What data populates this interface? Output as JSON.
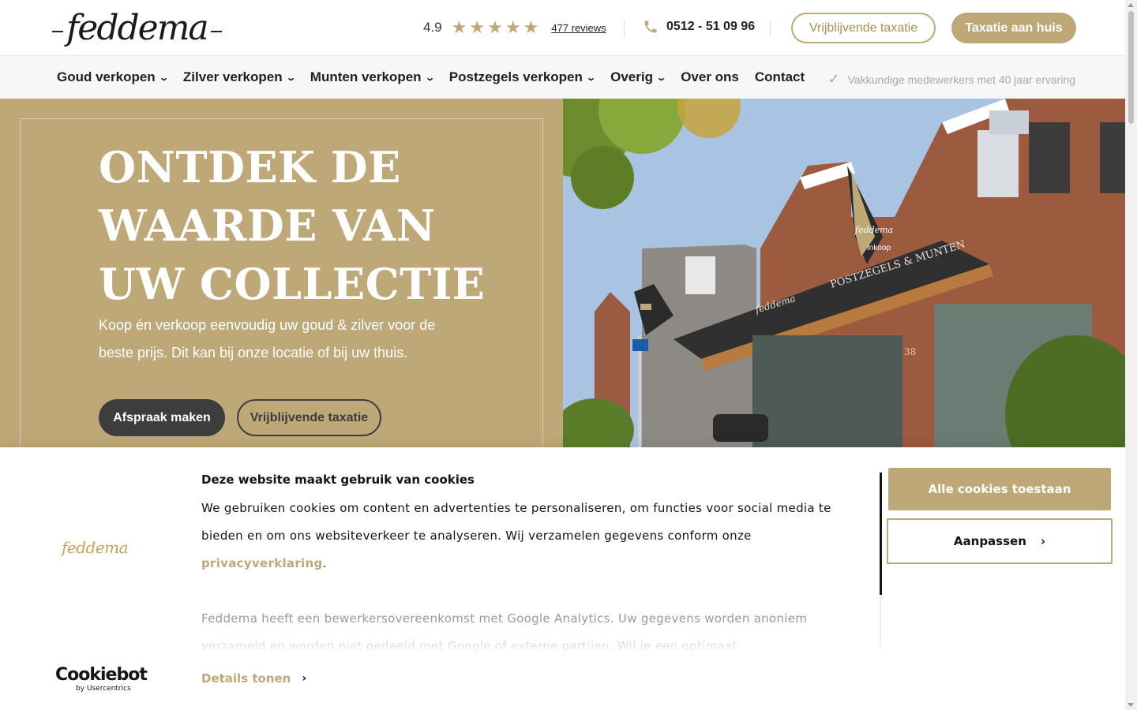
{
  "header": {
    "logo_text": "feddema",
    "rating_value": "4.9",
    "stars": 5,
    "reviews_label": "477 reviews",
    "phone": "0512 - 51 09 96",
    "btn_taxatie": "Vrijblijvende taxatie",
    "btn_aan_huis": "Taxatie aan huis"
  },
  "nav": {
    "items": [
      {
        "label": "Goud verkopen",
        "dropdown": true
      },
      {
        "label": "Zilver verkopen",
        "dropdown": true
      },
      {
        "label": "Munten verkopen",
        "dropdown": true
      },
      {
        "label": "Postzegels verkopen",
        "dropdown": true
      },
      {
        "label": "Overig",
        "dropdown": true
      },
      {
        "label": "Over ons",
        "dropdown": false
      },
      {
        "label": "Contact",
        "dropdown": false
      }
    ],
    "usp": "Vakkundige medewerkers met 40 jaar ervaring"
  },
  "hero": {
    "title": "ONTDEK DE WAARDE VAN UW COLLECTIE",
    "subtitle": "Koop én verkoop eenvoudig uw goud & zilver voor de beste prijs. Dit kan bij onze locatie of bij uw thuis.",
    "btn_primary": "Afspraak maken",
    "btn_secondary": "Vrijblijvende taxatie",
    "image_signs": {
      "awning_main": "POSTZEGELS & MUNTEN",
      "awning_logo": "feddema",
      "flag_logo": "feddema",
      "flag_text": "Inkoop",
      "house_number": "38"
    }
  },
  "cookie": {
    "logo_text": "feddema",
    "title": "Deze website maakt gebruik van cookies",
    "text_before_link": "We gebruiken cookies om content en advertenties te personaliseren, om functies voor social media te bieden en om ons websiteverkeer te analyseren. Wij verzamelen gegevens conform onze ",
    "link_label": "privacyverklaring",
    "text_after_link": ".",
    "text2": "Feddema heeft een bewerkersovereenkomst met Google Analytics. Uw gegevens worden anoniem verzameld en worden niet gedeeld met Google of externe partijen. Wil je een optimaal",
    "accept_label": "Alle cookies toestaan",
    "customize_label": "Aanpassen",
    "details_label": "Details tonen",
    "brand_main": "Cookiebot",
    "brand_by": "by Usercentrics"
  },
  "colors": {
    "gold": "#bfa877",
    "dark": "#3d3d3d",
    "text": "#141414"
  }
}
